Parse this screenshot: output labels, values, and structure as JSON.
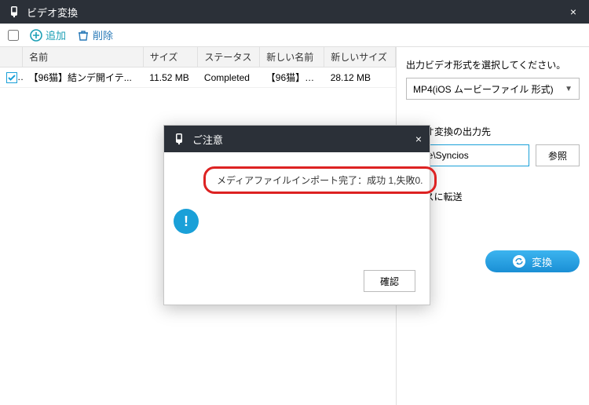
{
  "window": {
    "title": "ビデオ変換"
  },
  "toolbar": {
    "add_label": "追加",
    "delete_label": "削除"
  },
  "table": {
    "headers": {
      "name": "名前",
      "size": "サイズ",
      "status": "ステータス",
      "new_name": "新しい名前",
      "new_size": "新しいサイズ"
    },
    "rows": [
      {
        "checked": true,
        "name": "【96猫】結ンデ開イテ...",
        "size": "11.52 MB",
        "status": "Completed",
        "new_name": "【96猫】結...",
        "new_size": "28.12 MB"
      }
    ]
  },
  "right_panel": {
    "format_label": "出力ビデオ形式を選択してください。",
    "format_value": "MP4(iOS ムービーファイル 形式)",
    "output_label": "ビデオ変換の出力先",
    "output_path": "n file\\Syncios",
    "browse_label": "参照",
    "transfer_label": "バイスに転送",
    "convert_label": "変換"
  },
  "dialog": {
    "title": "ご注意",
    "message": "メディアファイルインポート完了：成功 1,失敗0.",
    "ok_label": "確認"
  }
}
